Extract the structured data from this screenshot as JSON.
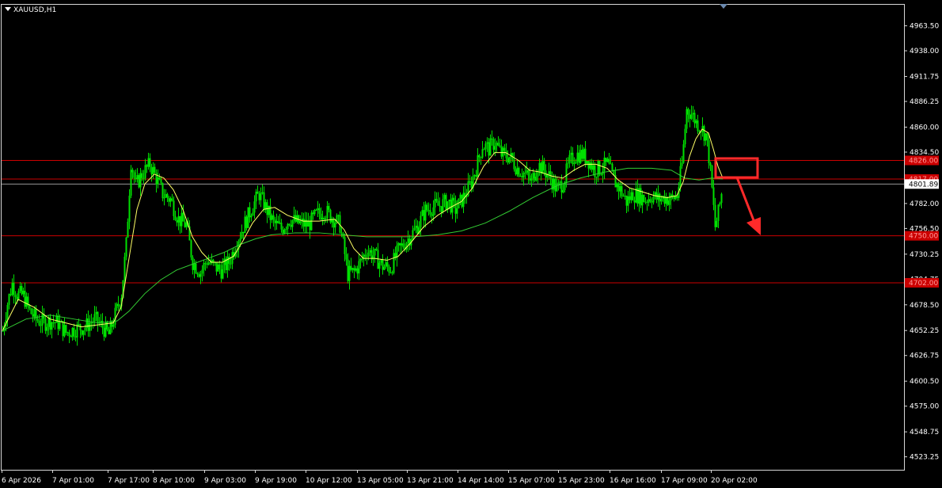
{
  "symbol_label": "XAUUSD,H1",
  "colors": {
    "background": "#000000",
    "axis_text": "#ffffff",
    "candle": "#00e000",
    "ma_fast": "#ffff66",
    "ma_slow": "#33cc33",
    "level_line": "#cc0000",
    "current_price_line": "#c8c8c8",
    "annotation": "#ff2a2a"
  },
  "chart_data": {
    "type": "candlestick",
    "timeframe": "H1",
    "ylim": [
      4510,
      4985
    ],
    "grid": false,
    "y_ticks": [
      "4963.50",
      "4938.00",
      "4911.75",
      "4886.25",
      "4860.00",
      "4834.50",
      "4808.25",
      "4782.00",
      "4756.50",
      "4730.25",
      "4704.75",
      "4678.50",
      "4652.25",
      "4626.75",
      "4600.50",
      "4575.00",
      "4548.75",
      "4523.25"
    ],
    "x_tick_labels": [
      "6 Apr 2026",
      "7 Apr 01:00",
      "7 Apr 17:00",
      "8 Apr 10:00",
      "9 Apr 03:00",
      "9 Apr 19:00",
      "10 Apr 12:00",
      "13 Apr 05:00",
      "13 Apr 21:00",
      "14 Apr 14:00",
      "15 Apr 07:00",
      "15 Apr 23:00",
      "16 Apr 16:00",
      "17 Apr 09:00",
      "20 Apr 02:00"
    ],
    "current_price": {
      "label": "4801.89",
      "value": 4801.89
    },
    "horizontal_levels": [
      {
        "label": "4826.00",
        "value": 4826
      },
      {
        "label": "4817.00",
        "value": 4807
      },
      {
        "label": "4750.00",
        "value": 4749
      },
      {
        "label": "4702.00",
        "value": 4701
      }
    ],
    "price_path": [
      [
        0,
        4652
      ],
      [
        6,
        4680
      ],
      [
        12,
        4700
      ],
      [
        18,
        4690
      ],
      [
        26,
        4688
      ],
      [
        34,
        4672
      ],
      [
        42,
        4664
      ],
      [
        52,
        4660
      ],
      [
        60,
        4662
      ],
      [
        70,
        4660
      ],
      [
        80,
        4650
      ],
      [
        92,
        4654
      ],
      [
        104,
        4656
      ],
      [
        116,
        4664
      ],
      [
        126,
        4656
      ],
      [
        134,
        4648
      ],
      [
        142,
        4668
      ],
      [
        150,
        4690
      ],
      [
        156,
        4740
      ],
      [
        162,
        4825
      ],
      [
        168,
        4800
      ],
      [
        176,
        4812
      ],
      [
        186,
        4822
      ],
      [
        194,
        4808
      ],
      [
        202,
        4792
      ],
      [
        212,
        4786
      ],
      [
        222,
        4766
      ],
      [
        232,
        4760
      ],
      [
        240,
        4722
      ],
      [
        250,
        4712
      ],
      [
        258,
        4724
      ],
      [
        266,
        4718
      ],
      [
        276,
        4714
      ],
      [
        286,
        4722
      ],
      [
        296,
        4744
      ],
      [
        306,
        4762
      ],
      [
        316,
        4780
      ],
      [
        324,
        4792
      ],
      [
        332,
        4778
      ],
      [
        342,
        4762
      ],
      [
        352,
        4756
      ],
      [
        362,
        4766
      ],
      [
        374,
        4762
      ],
      [
        386,
        4760
      ],
      [
        396,
        4770
      ],
      [
        406,
        4775
      ],
      [
        416,
        4768
      ],
      [
        426,
        4760
      ],
      [
        436,
        4710
      ],
      [
        444,
        4712
      ],
      [
        452,
        4722
      ],
      [
        460,
        4735
      ],
      [
        470,
        4728
      ],
      [
        480,
        4718
      ],
      [
        490,
        4716
      ],
      [
        500,
        4734
      ],
      [
        510,
        4744
      ],
      [
        518,
        4752
      ],
      [
        526,
        4762
      ],
      [
        534,
        4775
      ],
      [
        542,
        4778
      ],
      [
        552,
        4780
      ],
      [
        562,
        4784
      ],
      [
        572,
        4776
      ],
      [
        582,
        4788
      ],
      [
        590,
        4800
      ],
      [
        598,
        4818
      ],
      [
        606,
        4842
      ],
      [
        614,
        4838
      ],
      [
        622,
        4845
      ],
      [
        630,
        4832
      ],
      [
        640,
        4830
      ],
      [
        650,
        4818
      ],
      [
        660,
        4812
      ],
      [
        668,
        4804
      ],
      [
        676,
        4822
      ],
      [
        684,
        4816
      ],
      [
        692,
        4808
      ],
      [
        700,
        4796
      ],
      [
        708,
        4804
      ],
      [
        716,
        4824
      ],
      [
        724,
        4832
      ],
      [
        732,
        4832
      ],
      [
        740,
        4826
      ],
      [
        748,
        4816
      ],
      [
        756,
        4818
      ],
      [
        764,
        4822
      ],
      [
        772,
        4806
      ],
      [
        780,
        4796
      ],
      [
        788,
        4784
      ],
      [
        796,
        4792
      ],
      [
        804,
        4790
      ],
      [
        812,
        4786
      ],
      [
        820,
        4790
      ],
      [
        828,
        4786
      ],
      [
        836,
        4788
      ],
      [
        844,
        4786
      ],
      [
        852,
        4790
      ],
      [
        858,
        4822
      ],
      [
        864,
        4878
      ],
      [
        870,
        4874
      ],
      [
        876,
        4865
      ],
      [
        882,
        4860
      ],
      [
        888,
        4852
      ],
      [
        892,
        4830
      ],
      [
        896,
        4796
      ],
      [
        900,
        4758
      ],
      [
        904,
        4772
      ],
      [
        908,
        4792
      ]
    ],
    "ma_fast": [
      [
        0,
        4652
      ],
      [
        20,
        4684
      ],
      [
        40,
        4676
      ],
      [
        60,
        4664
      ],
      [
        80,
        4660
      ],
      [
        100,
        4656
      ],
      [
        120,
        4658
      ],
      [
        140,
        4660
      ],
      [
        150,
        4676
      ],
      [
        160,
        4726
      ],
      [
        170,
        4776
      ],
      [
        180,
        4802
      ],
      [
        192,
        4812
      ],
      [
        204,
        4808
      ],
      [
        216,
        4796
      ],
      [
        228,
        4776
      ],
      [
        240,
        4748
      ],
      [
        252,
        4732
      ],
      [
        264,
        4722
      ],
      [
        278,
        4722
      ],
      [
        292,
        4728
      ],
      [
        304,
        4744
      ],
      [
        316,
        4762
      ],
      [
        330,
        4776
      ],
      [
        344,
        4778
      ],
      [
        360,
        4770
      ],
      [
        380,
        4764
      ],
      [
        400,
        4764
      ],
      [
        420,
        4766
      ],
      [
        432,
        4755
      ],
      [
        444,
        4736
      ],
      [
        456,
        4726
      ],
      [
        470,
        4726
      ],
      [
        486,
        4724
      ],
      [
        500,
        4728
      ],
      [
        516,
        4742
      ],
      [
        532,
        4758
      ],
      [
        550,
        4770
      ],
      [
        566,
        4778
      ],
      [
        580,
        4784
      ],
      [
        594,
        4798
      ],
      [
        608,
        4820
      ],
      [
        622,
        4834
      ],
      [
        636,
        4834
      ],
      [
        652,
        4826
      ],
      [
        666,
        4816
      ],
      [
        680,
        4814
      ],
      [
        694,
        4810
      ],
      [
        708,
        4808
      ],
      [
        722,
        4816
      ],
      [
        736,
        4822
      ],
      [
        750,
        4822
      ],
      [
        764,
        4818
      ],
      [
        778,
        4806
      ],
      [
        792,
        4798
      ],
      [
        808,
        4794
      ],
      [
        824,
        4790
      ],
      [
        840,
        4788
      ],
      [
        852,
        4790
      ],
      [
        860,
        4804
      ],
      [
        868,
        4830
      ],
      [
        876,
        4848
      ],
      [
        884,
        4858
      ],
      [
        892,
        4854
      ],
      [
        898,
        4838
      ],
      [
        904,
        4820
      ],
      [
        910,
        4808
      ]
    ],
    "ma_slow": [
      [
        0,
        4652
      ],
      [
        30,
        4664
      ],
      [
        60,
        4668
      ],
      [
        90,
        4664
      ],
      [
        120,
        4660
      ],
      [
        145,
        4662
      ],
      [
        160,
        4672
      ],
      [
        180,
        4690
      ],
      [
        200,
        4704
      ],
      [
        220,
        4714
      ],
      [
        240,
        4720
      ],
      [
        260,
        4726
      ],
      [
        280,
        4732
      ],
      [
        300,
        4740
      ],
      [
        320,
        4746
      ],
      [
        340,
        4750
      ],
      [
        370,
        4752
      ],
      [
        400,
        4752
      ],
      [
        430,
        4750
      ],
      [
        460,
        4748
      ],
      [
        490,
        4748
      ],
      [
        520,
        4748
      ],
      [
        550,
        4750
      ],
      [
        580,
        4754
      ],
      [
        610,
        4762
      ],
      [
        640,
        4774
      ],
      [
        670,
        4788
      ],
      [
        700,
        4800
      ],
      [
        730,
        4808
      ],
      [
        760,
        4814
      ],
      [
        790,
        4818
      ],
      [
        820,
        4818
      ],
      [
        845,
        4816
      ],
      [
        862,
        4808
      ],
      [
        880,
        4806
      ],
      [
        896,
        4808
      ],
      [
        910,
        4807
      ]
    ]
  }
}
